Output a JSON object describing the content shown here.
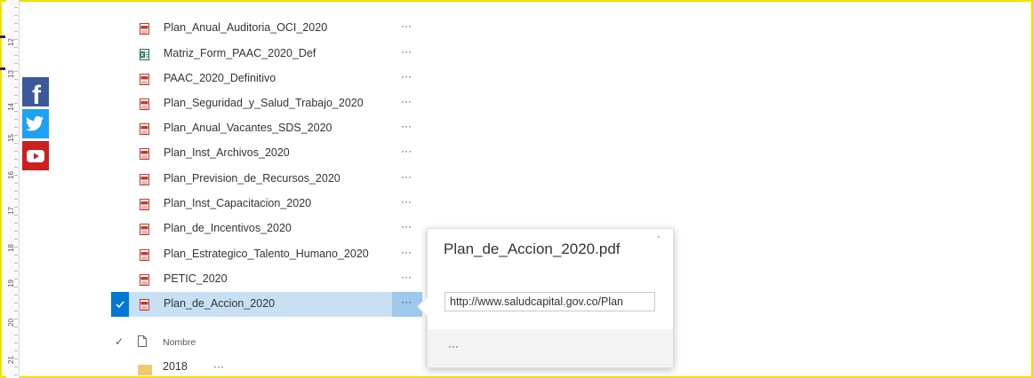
{
  "ruler": {
    "numbers": [
      "12",
      "13",
      "14",
      "15",
      "16",
      "17",
      "18",
      "19",
      "20",
      "21"
    ]
  },
  "social": {
    "facebook_glyph": "f"
  },
  "files": [
    {
      "name": "Plan_Anual_Auditoria_OCI_2020",
      "icon": "pdf-icon"
    },
    {
      "name": "Matriz_Form_PAAC_2020_Def",
      "icon": "excel-icon"
    },
    {
      "name": "PAAC_2020_Definitivo",
      "icon": "pdf-icon"
    },
    {
      "name": "Plan_Seguridad_y_Salud_Trabajo_2020",
      "icon": "pdf-icon"
    },
    {
      "name": "Plan_Anual_Vacantes_SDS_2020",
      "icon": "pdf-icon"
    },
    {
      "name": "Plan_Inst_Archivos_2020",
      "icon": "pdf-icon"
    },
    {
      "name": "Plan_Prevision_de_Recursos_2020",
      "icon": "pdf-icon"
    },
    {
      "name": "Plan_Inst_Capacitacion_2020",
      "icon": "pdf-icon"
    },
    {
      "name": "Plan_de_Incentivos_2020",
      "icon": "pdf-icon"
    },
    {
      "name": "Plan_Estrategico_Talento_Humano_2020",
      "icon": "pdf-icon"
    },
    {
      "name": "PETIC_2020",
      "icon": "pdf-icon"
    },
    {
      "name": "Plan_de_Accion_2020",
      "icon": "pdf-icon",
      "selected": true
    }
  ],
  "more_label": "···",
  "checkmark": "✓",
  "header": {
    "name_label": "Nombre"
  },
  "folder": {
    "name": "2018"
  },
  "callout": {
    "title": "Plan_de_Accion_2020.pdf",
    "close_glyph": "`",
    "url": "http://www.saludcapital.gov.co/Plan",
    "footer_more": "···"
  },
  "colors": {
    "accent": "#0078d4",
    "selected_row": "#c7e0f4",
    "frame": "#f0e000",
    "pdf": "#c0392b",
    "excel": "#1e7145"
  }
}
